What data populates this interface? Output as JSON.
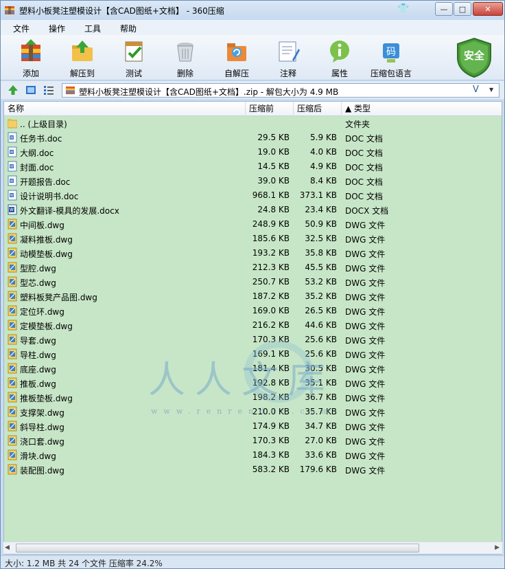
{
  "window": {
    "title": "塑料小板凳注塑模设计【含CAD图纸+文档】 - 360压缩"
  },
  "menu": [
    "文件",
    "操作",
    "工具",
    "帮助"
  ],
  "toolbar": {
    "add": "添加",
    "extract": "解压到",
    "test": "测试",
    "delete": "删除",
    "sfx": "自解压",
    "comment": "注释",
    "properties": "属性",
    "language": "压缩包语言",
    "security": "安全"
  },
  "address": {
    "path": "塑料小板凳注塑模设计【含CAD图纸+文档】.zip - 解包大小为 4.9 MB"
  },
  "columns": {
    "name": "名称",
    "compressed": "压缩前",
    "packed": "压缩后",
    "type": "▲ 类型"
  },
  "files": [
    {
      "name": ".. (上级目录)",
      "compressed": "",
      "packed": "",
      "type": "文件夹",
      "icon": "folder-icon"
    },
    {
      "name": "任务书.doc",
      "compressed": "29.5 KB",
      "packed": "5.9 KB",
      "type": "DOC 文档",
      "icon": "doc-icon"
    },
    {
      "name": "大纲.doc",
      "compressed": "19.0 KB",
      "packed": "4.0 KB",
      "type": "DOC 文档",
      "icon": "doc-icon"
    },
    {
      "name": "封面.doc",
      "compressed": "14.5 KB",
      "packed": "4.9 KB",
      "type": "DOC 文档",
      "icon": "doc-icon"
    },
    {
      "name": "开题报告.doc",
      "compressed": "39.0 KB",
      "packed": "8.4 KB",
      "type": "DOC 文档",
      "icon": "doc-icon"
    },
    {
      "name": "设计说明书.doc",
      "compressed": "968.1 KB",
      "packed": "373.1 KB",
      "type": "DOC 文档",
      "icon": "doc-icon"
    },
    {
      "name": "外文翻译-模具的发展.docx",
      "compressed": "24.8 KB",
      "packed": "23.4 KB",
      "type": "DOCX 文档",
      "icon": "docx-icon"
    },
    {
      "name": "中间板.dwg",
      "compressed": "248.9 KB",
      "packed": "50.9 KB",
      "type": "DWG 文件",
      "icon": "dwg-icon"
    },
    {
      "name": "凝料推板.dwg",
      "compressed": "185.6 KB",
      "packed": "32.5 KB",
      "type": "DWG 文件",
      "icon": "dwg-icon"
    },
    {
      "name": "动模垫板.dwg",
      "compressed": "193.2 KB",
      "packed": "35.8 KB",
      "type": "DWG 文件",
      "icon": "dwg-icon"
    },
    {
      "name": "型腔.dwg",
      "compressed": "212.3 KB",
      "packed": "45.5 KB",
      "type": "DWG 文件",
      "icon": "dwg-icon"
    },
    {
      "name": "型芯.dwg",
      "compressed": "250.7 KB",
      "packed": "53.2 KB",
      "type": "DWG 文件",
      "icon": "dwg-icon"
    },
    {
      "name": "塑料板凳产品图.dwg",
      "compressed": "187.2 KB",
      "packed": "35.2 KB",
      "type": "DWG 文件",
      "icon": "dwg-icon"
    },
    {
      "name": "定位环.dwg",
      "compressed": "169.0 KB",
      "packed": "26.5 KB",
      "type": "DWG 文件",
      "icon": "dwg-icon"
    },
    {
      "name": "定模垫板.dwg",
      "compressed": "216.2 KB",
      "packed": "44.6 KB",
      "type": "DWG 文件",
      "icon": "dwg-icon"
    },
    {
      "name": "导套.dwg",
      "compressed": "170.3 KB",
      "packed": "25.6 KB",
      "type": "DWG 文件",
      "icon": "dwg-icon"
    },
    {
      "name": "导柱.dwg",
      "compressed": "169.1 KB",
      "packed": "25.6 KB",
      "type": "DWG 文件",
      "icon": "dwg-icon"
    },
    {
      "name": "底座.dwg",
      "compressed": "181.4 KB",
      "packed": "30.5 KB",
      "type": "DWG 文件",
      "icon": "dwg-icon"
    },
    {
      "name": "推板.dwg",
      "compressed": "192.8 KB",
      "packed": "35.1 KB",
      "type": "DWG 文件",
      "icon": "dwg-icon"
    },
    {
      "name": "推板垫板.dwg",
      "compressed": "198.2 KB",
      "packed": "36.7 KB",
      "type": "DWG 文件",
      "icon": "dwg-icon"
    },
    {
      "name": "支撑架.dwg",
      "compressed": "210.0 KB",
      "packed": "35.7 KB",
      "type": "DWG 文件",
      "icon": "dwg-icon"
    },
    {
      "name": "斜导柱.dwg",
      "compressed": "174.9 KB",
      "packed": "34.7 KB",
      "type": "DWG 文件",
      "icon": "dwg-icon"
    },
    {
      "name": "浇口套.dwg",
      "compressed": "170.3 KB",
      "packed": "27.0 KB",
      "type": "DWG 文件",
      "icon": "dwg-icon"
    },
    {
      "name": "滑块.dwg",
      "compressed": "184.3 KB",
      "packed": "33.6 KB",
      "type": "DWG 文件",
      "icon": "dwg-icon"
    },
    {
      "name": "装配图.dwg",
      "compressed": "583.2 KB",
      "packed": "179.6 KB",
      "type": "DWG 文件",
      "icon": "dwg-icon"
    }
  ],
  "watermark": {
    "text": "人人文库",
    "url": "www.renrendoc.com"
  },
  "status": {
    "text": "大小: 1.2 MB 共 24 个文件 压缩率 24.2%"
  },
  "colors": {
    "list_background": "#c7e6c7",
    "title_bar": "#c6d9ef",
    "shield": "#4a9a3a"
  }
}
